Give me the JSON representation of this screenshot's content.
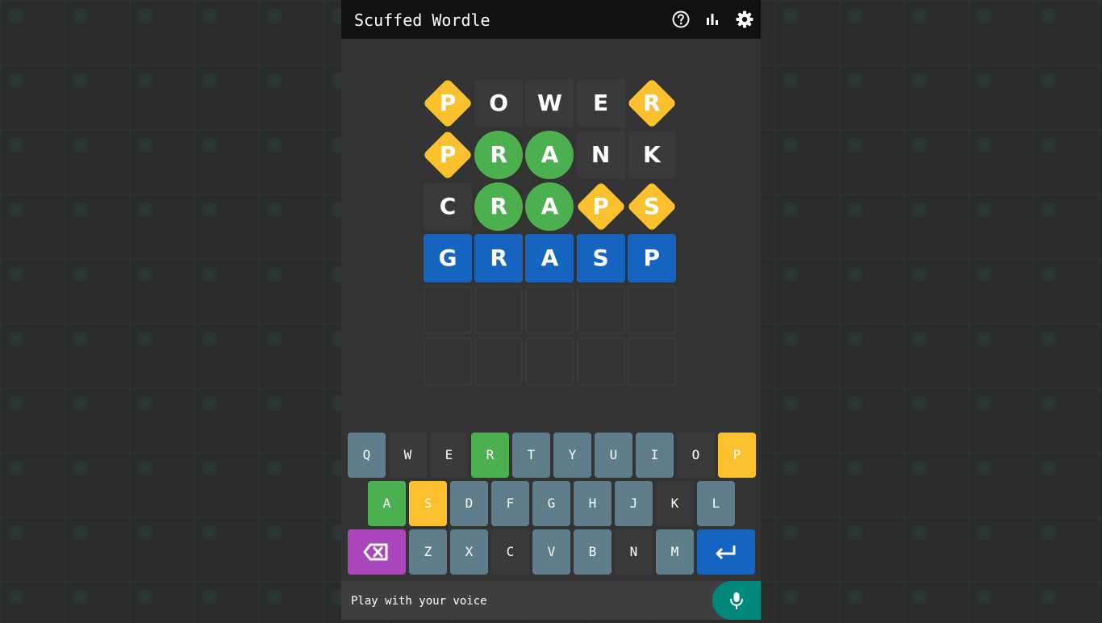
{
  "header": {
    "title": "Scuffed Wordle",
    "icons": [
      "help-icon",
      "stats-icon",
      "settings-icon"
    ]
  },
  "board": {
    "rows": [
      [
        {
          "l": "P",
          "s": "present"
        },
        {
          "l": "O",
          "s": "absent"
        },
        {
          "l": "W",
          "s": "absent"
        },
        {
          "l": "E",
          "s": "absent"
        },
        {
          "l": "R",
          "s": "present"
        }
      ],
      [
        {
          "l": "P",
          "s": "present"
        },
        {
          "l": "R",
          "s": "correct"
        },
        {
          "l": "A",
          "s": "correct"
        },
        {
          "l": "N",
          "s": "absent"
        },
        {
          "l": "K",
          "s": "absent"
        }
      ],
      [
        {
          "l": "C",
          "s": "absent"
        },
        {
          "l": "R",
          "s": "correct"
        },
        {
          "l": "A",
          "s": "correct"
        },
        {
          "l": "P",
          "s": "present"
        },
        {
          "l": "S",
          "s": "present"
        }
      ],
      [
        {
          "l": "G",
          "s": "answer"
        },
        {
          "l": "R",
          "s": "answer"
        },
        {
          "l": "A",
          "s": "answer"
        },
        {
          "l": "S",
          "s": "answer"
        },
        {
          "l": "P",
          "s": "answer"
        }
      ],
      [
        {
          "l": "",
          "s": "empty"
        },
        {
          "l": "",
          "s": "empty"
        },
        {
          "l": "",
          "s": "empty"
        },
        {
          "l": "",
          "s": "empty"
        },
        {
          "l": "",
          "s": "empty"
        }
      ],
      [
        {
          "l": "",
          "s": "empty"
        },
        {
          "l": "",
          "s": "empty"
        },
        {
          "l": "",
          "s": "empty"
        },
        {
          "l": "",
          "s": "empty"
        },
        {
          "l": "",
          "s": "empty"
        }
      ]
    ]
  },
  "keyboard": {
    "rows": [
      [
        {
          "k": "Q",
          "s": "unused"
        },
        {
          "k": "W",
          "s": "absent"
        },
        {
          "k": "E",
          "s": "absent"
        },
        {
          "k": "R",
          "s": "correct"
        },
        {
          "k": "T",
          "s": "unused"
        },
        {
          "k": "Y",
          "s": "unused"
        },
        {
          "k": "U",
          "s": "unused"
        },
        {
          "k": "I",
          "s": "unused"
        },
        {
          "k": "O",
          "s": "absent"
        },
        {
          "k": "P",
          "s": "present"
        }
      ],
      [
        {
          "k": "A",
          "s": "correct"
        },
        {
          "k": "S",
          "s": "present"
        },
        {
          "k": "D",
          "s": "unused"
        },
        {
          "k": "F",
          "s": "unused"
        },
        {
          "k": "G",
          "s": "unused"
        },
        {
          "k": "H",
          "s": "unused"
        },
        {
          "k": "J",
          "s": "unused"
        },
        {
          "k": "K",
          "s": "absent"
        },
        {
          "k": "L",
          "s": "unused"
        }
      ],
      [
        {
          "k": "",
          "s": "back"
        },
        {
          "k": "Z",
          "s": "unused"
        },
        {
          "k": "X",
          "s": "unused"
        },
        {
          "k": "C",
          "s": "absent"
        },
        {
          "k": "V",
          "s": "unused"
        },
        {
          "k": "B",
          "s": "unused"
        },
        {
          "k": "N",
          "s": "absent"
        },
        {
          "k": "M",
          "s": "unused"
        },
        {
          "k": "",
          "s": "enter"
        }
      ]
    ],
    "backspace_icon": "backspace-icon",
    "enter_icon": "enter-icon"
  },
  "voice": {
    "label": "Play with your voice",
    "icon": "microphone-icon"
  },
  "colors": {
    "correct": "#4caf50",
    "present": "#fbc02d",
    "absent": "#3a3a3c",
    "answer": "#1565c0",
    "unused": "#607d8b",
    "backspace": "#ab47bc",
    "voice": "#00897b"
  }
}
